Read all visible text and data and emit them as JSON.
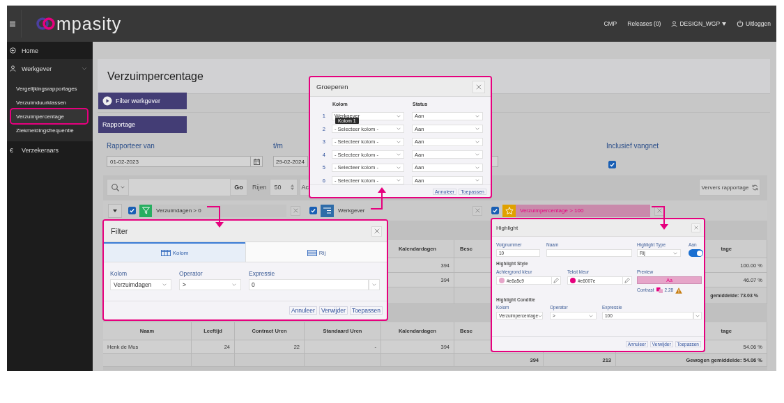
{
  "header": {
    "logo": "mpasity",
    "links": [
      {
        "kind": "text",
        "label": "CMP"
      },
      {
        "kind": "text",
        "label": "Releases (0)"
      },
      {
        "kind": "user",
        "label": "DESIGN_WGP"
      },
      {
        "kind": "logout",
        "label": "Uitloggen"
      }
    ]
  },
  "sidebar": {
    "items": [
      {
        "kind": "home",
        "label": "Home"
      },
      {
        "kind": "user",
        "label": "Werkgever",
        "expanded": true,
        "children": [
          {
            "label": "Vergelijkingsrapportages",
            "selected": false
          },
          {
            "label": "Verzuimduurklassen",
            "selected": false
          },
          {
            "label": "Verzuimpercentage",
            "selected": true
          },
          {
            "label": "Ziekmeldingsfrequentie",
            "selected": false
          }
        ]
      },
      {
        "kind": "euro",
        "symbol": "€",
        "label": "Verzekeraars"
      }
    ]
  },
  "page": {
    "title": "Verzuimpercentage",
    "regions": [
      {
        "kind": "collapsible",
        "label": "Filter werkgever"
      },
      {
        "kind": "plain",
        "label": "Rapportage"
      }
    ],
    "form": {
      "date_from": {
        "label": "Rapporteer van",
        "value": "01-02-2023"
      },
      "date_to": {
        "label": "t/m",
        "value": "29-02-2024"
      },
      "safety_net": {
        "label": "Inclusief vangnet",
        "checked": true
      }
    },
    "toolbar": {
      "go_button": "Go",
      "rows_label": "Rijen",
      "rows_value": "50",
      "actions_button": "Ac",
      "refresh_button": "Ververs rapportage"
    },
    "chips": [
      {
        "kind": "filter",
        "label": "Verzuimdagen > 0",
        "checked": true
      },
      {
        "kind": "group",
        "label": "Werkgever",
        "checked": true
      },
      {
        "kind": "highlight",
        "label": "Verzuimpercentage > 100",
        "checked": true
      }
    ],
    "table_1": {
      "header": {
        "kalendardagen": "Kalendardagen",
        "column_6": "Besc",
        "column_8": "tage"
      },
      "rows": [
        {
          "kalendardagen": "394",
          "column_8": "100.00 %"
        },
        {
          "kalendardagen": "394",
          "column_8": "46.07 %"
        }
      ],
      "total": {
        "column_8": "gemiddelde: 73.03 %"
      }
    },
    "table_2": {
      "header": {
        "naam": "Naam",
        "leeftijd": "Leeftijd",
        "contract_uren": "Contract Uren",
        "standaard_uren": "Standaard Uren",
        "kalendardagen": "Kalendardagen",
        "column_6": "Besc",
        "column_8": "tage"
      },
      "rows": [
        {
          "naam": "Henk de Mus",
          "leeftijd": "24",
          "contract_uren": "22",
          "standaard_uren": "-",
          "kalendardagen": "394",
          "column_8": "54.06 %"
        }
      ],
      "total": {
        "column_6": "394",
        "column_7": "213",
        "column_8": "Gewogen gemiddelde: 54.06 %"
      }
    }
  },
  "group_dialog": {
    "title": "Groeperen",
    "column_header": "Kolom",
    "status_header": "Status",
    "rows": [
      {
        "number": "1",
        "column": "Werkgever",
        "status": "Aan"
      },
      {
        "number": "2",
        "placeholder": "- Selecteer kolom -",
        "status": "Aan"
      },
      {
        "number": "3",
        "placeholder": "- Selecteer kolom -",
        "status": "Aan"
      },
      {
        "number": "4",
        "placeholder": "- Selecteer kolom -",
        "status": "Aan"
      },
      {
        "number": "5",
        "placeholder": "- Selecteer kolom -",
        "status": "Aan"
      },
      {
        "number": "6",
        "placeholder": "- Selecteer kolom -",
        "status": "Aan"
      }
    ],
    "tooltip": "Kolom 1",
    "buttons": [
      "Annuleer",
      "Toepassen"
    ]
  },
  "filter_dialog": {
    "title": "Filter",
    "tabs": [
      {
        "kind": "columns",
        "label": "Kolom",
        "selected": true
      },
      {
        "kind": "rows",
        "label": "Rij",
        "selected": false
      }
    ],
    "column": {
      "label": "Kolom",
      "value": "Verzuimdagen"
    },
    "operator": {
      "label": "Operator",
      "value": ">"
    },
    "expression": {
      "label": "Expressie",
      "value": "0"
    },
    "buttons": [
      "Annuleer",
      "Verwijder",
      "Toepassen"
    ]
  },
  "highlight_dialog": {
    "title": "Highlight",
    "sequence": {
      "label": "Volgnummer",
      "value": "10"
    },
    "name": {
      "label": "Naam"
    },
    "type": {
      "label": "Highlight Type",
      "value": "Rij"
    },
    "enabled": {
      "label": "Aan",
      "on": true
    },
    "style_heading": "Highlight Style",
    "background": {
      "label": "Achtergrond kleur",
      "value": "#e6a5c9"
    },
    "text_color": {
      "label": "Tekst kleur",
      "value": "#e6007e"
    },
    "preview": {
      "label": "Preview",
      "sample": "Aa"
    },
    "contrast": {
      "label": "Contrast",
      "value": "2.28"
    },
    "condition_heading": "Highlight Conditie",
    "column": {
      "label": "Kolom",
      "value": "Verzuimpercentage"
    },
    "operator": {
      "label": "Operator",
      "value": ">"
    },
    "expression": {
      "label": "Expressie",
      "value": "100"
    },
    "buttons": [
      "Annuleer",
      "Verwijder",
      "Toepassen"
    ]
  }
}
